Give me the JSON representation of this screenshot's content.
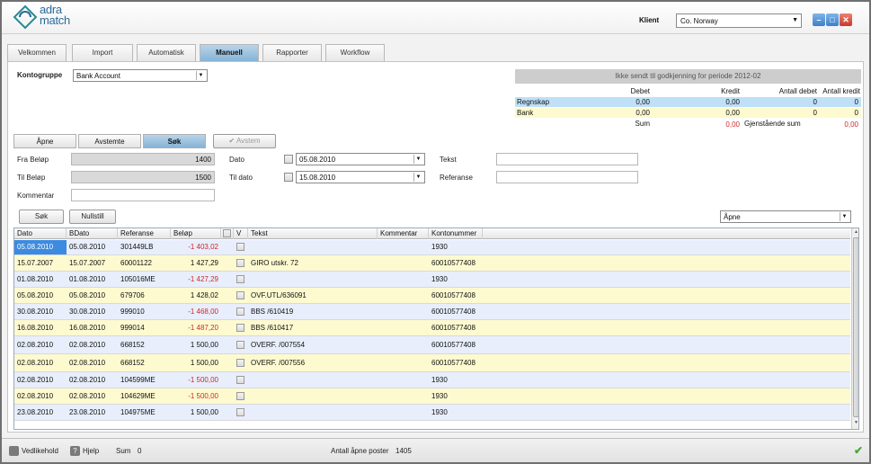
{
  "app": {
    "logo_text_line1": "adra",
    "logo_text_line2": "match",
    "klient_label": "Klient",
    "klient_value": "Co. Norway"
  },
  "tabs": [
    {
      "label": "Velkommen"
    },
    {
      "label": "Import"
    },
    {
      "label": "Automatisk"
    },
    {
      "label": "Manuell"
    },
    {
      "label": "Rapporter"
    },
    {
      "label": "Workflow"
    }
  ],
  "form": {
    "kontogruppe_label": "Kontogruppe",
    "kontogruppe_value": "Bank Account",
    "fra_belop_label": "Fra Beløp",
    "fra_belop_value": "1400",
    "til_belop_label": "Til Beløp",
    "til_belop_value": "1500",
    "kommentar_label": "Kommentar",
    "kommentar_value": "",
    "dato_label": "Dato",
    "dato_value": "05.08.2010",
    "til_dato_label": "Til dato",
    "til_dato_value": "15.08.2010",
    "tekst_label": "Tekst",
    "tekst_value": "",
    "referanse_label": "Referanse",
    "referanse_value": "",
    "sok_button": "Søk",
    "nullstill_button": "Nullstill",
    "status_select": "Åpne"
  },
  "subtabs": [
    {
      "label": "Åpne"
    },
    {
      "label": "Avstemte"
    },
    {
      "label": "Søk"
    },
    {
      "label": "Avstem"
    }
  ],
  "summary": {
    "header": "Ikke sendt til godkjenning for periode 2012-02",
    "col_debet": "Debet",
    "col_kredit": "Kredit",
    "col_antall_debet": "Antall debet",
    "col_antall_kredit": "Antall kredit",
    "regnskap_label": "Regnskap",
    "regnskap_debet": "0,00",
    "regnskap_kredit": "0,00",
    "regnskap_antall_debet": "0",
    "regnskap_antall_kredit": "0",
    "bank_label": "Bank",
    "bank_debet": "0,00",
    "bank_kredit": "0,00",
    "bank_antall_debet": "0",
    "bank_antall_kredit": "0",
    "sum_label": "Sum",
    "sum_debet": "0,00",
    "sum_kredit": "0,00",
    "gjenstaende_label": "Gjenstående sum",
    "gjenstaende_value": "0,00"
  },
  "table": {
    "headers": [
      "Dato",
      "BDato",
      "Referanse",
      "Beløp",
      "V",
      "Tekst",
      "Kommentar",
      "Kontonummer"
    ],
    "rows": [
      {
        "dato": "05.08.2010",
        "bdato": "05.08.2010",
        "ref": "301449LB",
        "belop": "-1 403,02",
        "neg": true,
        "tekst": "",
        "konto": "1930"
      },
      {
        "dato": "15.07.2007",
        "bdato": "15.07.2007",
        "ref": "60001122",
        "belop": "1 427,29",
        "neg": false,
        "tekst": "GIRO utskr. 72",
        "konto": "60010577408"
      },
      {
        "dato": "01.08.2010",
        "bdato": "01.08.2010",
        "ref": "105016ME",
        "belop": "-1 427,29",
        "neg": true,
        "tekst": "",
        "konto": "1930"
      },
      {
        "dato": "05.08.2010",
        "bdato": "05.08.2010",
        "ref": "679706",
        "belop": "1 428,02",
        "neg": false,
        "tekst": "OVF.UTL/636091",
        "konto": "60010577408"
      },
      {
        "dato": "30.08.2010",
        "bdato": "30.08.2010",
        "ref": "999010",
        "belop": "-1 468,00",
        "neg": true,
        "tekst": "BBS  /610419",
        "konto": "60010577408"
      },
      {
        "dato": "16.08.2010",
        "bdato": "16.08.2010",
        "ref": "999014",
        "belop": "-1 487,20",
        "neg": true,
        "tekst": "BBS  /610417",
        "konto": "60010577408"
      },
      {
        "dato": "02.08.2010",
        "bdato": "02.08.2010",
        "ref": "668152",
        "belop": "1 500,00",
        "neg": false,
        "tekst": "OVERF. /007554",
        "konto": "60010577408"
      },
      {
        "dato": "02.08.2010",
        "bdato": "02.08.2010",
        "ref": "668152",
        "belop": "1 500,00",
        "neg": false,
        "tekst": "OVERF. /007556",
        "konto": "60010577408"
      },
      {
        "dato": "02.08.2010",
        "bdato": "02.08.2010",
        "ref": "104599ME",
        "belop": "-1 500,00",
        "neg": true,
        "tekst": "",
        "konto": "1930"
      },
      {
        "dato": "02.08.2010",
        "bdato": "02.08.2010",
        "ref": "104629ME",
        "belop": "-1 500,00",
        "neg": true,
        "tekst": "",
        "konto": "1930"
      },
      {
        "dato": "23.08.2010",
        "bdato": "23.08.2010",
        "ref": "104975ME",
        "belop": "1 500,00",
        "neg": false,
        "tekst": "",
        "konto": "1930"
      }
    ]
  },
  "statusbar": {
    "vedlikehold": "Vedlikehold",
    "hjelp": "Hjelp",
    "sum_label": "Sum",
    "sum_value": "0",
    "antall_label": "Antall åpne poster",
    "antall_value": "1405"
  },
  "colors": {
    "accent": "#86b3d6",
    "negative": "#cc2a2a",
    "row_blue": "#e8eefc",
    "row_yellow": "#fdfad0"
  }
}
